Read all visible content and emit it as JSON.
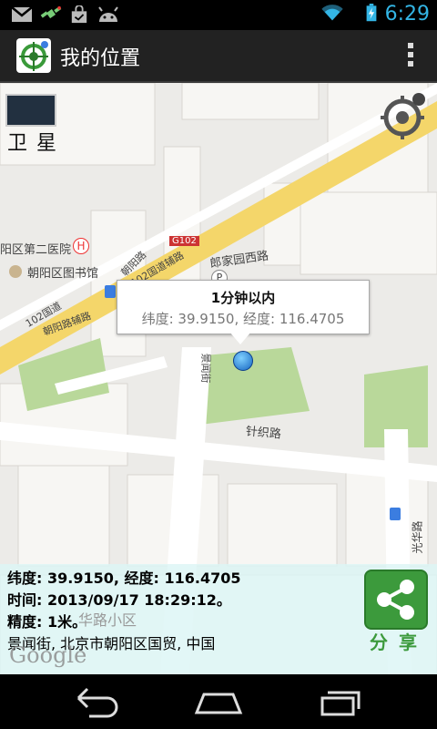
{
  "status_bar": {
    "time": "6:29",
    "icons": [
      "gmail-icon",
      "satellite-notification-icon",
      "shopping-bag-icon",
      "android-icon",
      "wifi-icon",
      "battery-charging-icon"
    ],
    "accent_color": "#33b5e5"
  },
  "action_bar": {
    "title": "我的位置",
    "overflow_icon": "overflow-menu-icon"
  },
  "map": {
    "satellite_button_label": "卫星",
    "locate_button_icon": "gps-locate-icon",
    "labels": {
      "hospital": "阳区第二医院",
      "library": "朝阳区图书馆",
      "road_g102_badge": "G102",
      "road_lang": "郎家园西路",
      "road_zhenzhi": "针织路",
      "road_102_left": "102国道",
      "road_chaoyang_road": "朝阳路",
      "road_102_fuzhu": "102国道辅路",
      "road_jingwen": "景闻街",
      "road_chaoyang_fuzhu": "朝阳路辅路",
      "road_side_right": "光华路",
      "residential": "华路小区"
    },
    "popup": {
      "title": "1分钟以内",
      "coords": "纬度: 39.9150, 经度: 116.4705"
    },
    "google_logo": "Google"
  },
  "info_panel": {
    "coords_line": "纬度: 39.9150, 经度: 116.4705",
    "time_line": "时间: 2013/09/17 18:29:12。",
    "accuracy_line": "精度: 1米。",
    "address_line": "景闻街, 北京市朝阳区国贸, 中国",
    "share_label": "分享",
    "share_color": "#3c9a3c"
  },
  "nav_bar": {
    "buttons": [
      "back-icon",
      "home-icon",
      "recent-apps-icon"
    ]
  }
}
